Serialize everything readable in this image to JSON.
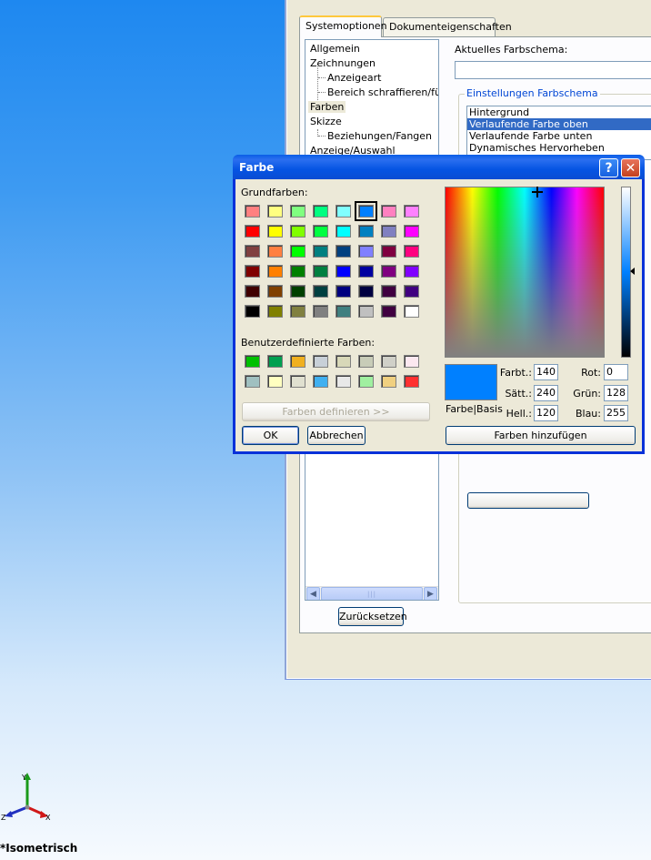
{
  "options": {
    "tabs": [
      "Systemoptionen",
      "Dokumenteigenschaften"
    ],
    "tree": [
      "Allgemein",
      "Zeichnungen",
      "Anzeigeart",
      "Bereich schraffieren/füllen",
      "Farben",
      "Skizze",
      "Beziehungen/Fangen",
      "Anzeige/Auswahl"
    ],
    "current_scheme_label": "Aktuelles Farbschema:",
    "current_scheme_value": "",
    "group_title": "Einstellungen Farbschema",
    "scheme_items": [
      "Hintergrund",
      "Verlaufende Farbe oben",
      "Verlaufende Farbe unten",
      "Dynamisches Hervorheben"
    ],
    "reset_button": "Zurücksetzen",
    "scroll_grip": "|||"
  },
  "dialog": {
    "title": "Farbe",
    "help_label": "?",
    "close_label": "✕",
    "basic_colors_label": "Grundfarben:",
    "custom_colors_label": "Benutzerdefinierte Farben:",
    "define_button": "Farben definieren >>",
    "ok_button": "OK",
    "cancel_button": "Abbrechen",
    "add_button": "Farben hinzufügen",
    "color_solid_label": "Farbe|Basis",
    "hue_label": "Farbt.:",
    "hue": "140",
    "sat_label": "Sätt.:",
    "sat": "240",
    "lum_label": "Hell.:",
    "lum": "120",
    "red_label": "Rot:",
    "red": "0",
    "green_label": "Grün:",
    "green": "128",
    "blue_label": "Blau:",
    "blue": "255",
    "selected_color": "#0080ff",
    "basic_colors": [
      [
        "#ff8080",
        "#ffff80",
        "#80ff80",
        "#00ff80",
        "#80ffff",
        "#0080ff",
        "#ff80c0",
        "#ff80ff"
      ],
      [
        "#ff0000",
        "#ffff00",
        "#80ff00",
        "#00ff40",
        "#00ffff",
        "#0080c0",
        "#8080c0",
        "#ff00ff"
      ],
      [
        "#804040",
        "#ff8040",
        "#00ff00",
        "#008080",
        "#004080",
        "#8080ff",
        "#800040",
        "#ff0080"
      ],
      [
        "#800000",
        "#ff8000",
        "#008000",
        "#008040",
        "#0000ff",
        "#0000a0",
        "#800080",
        "#8000ff"
      ],
      [
        "#400000",
        "#804000",
        "#004000",
        "#004040",
        "#000080",
        "#000040",
        "#400040",
        "#400080"
      ],
      [
        "#000000",
        "#808000",
        "#808040",
        "#808080",
        "#408080",
        "#c0c0c0",
        "#400040",
        "#ffffff"
      ]
    ],
    "custom_colors": [
      [
        "#00c000",
        "#00a050",
        "#f0b020",
        "#c8d0d8",
        "#d8d8b8",
        "#c8ccb8",
        "#d0d0c8",
        "#fce8f0"
      ],
      [
        "#a0c0c0",
        "#ffffc0",
        "#e0e0d0",
        "#40b0f0",
        "#e8e8e8",
        "#a0f0a0",
        "#f0d080",
        "#ff3030"
      ]
    ],
    "selected_basic": [
      0,
      5
    ]
  },
  "viewport": {
    "view_name": "*Isometrisch",
    "triad_labels": [
      "Y",
      "Z",
      "X"
    ]
  }
}
